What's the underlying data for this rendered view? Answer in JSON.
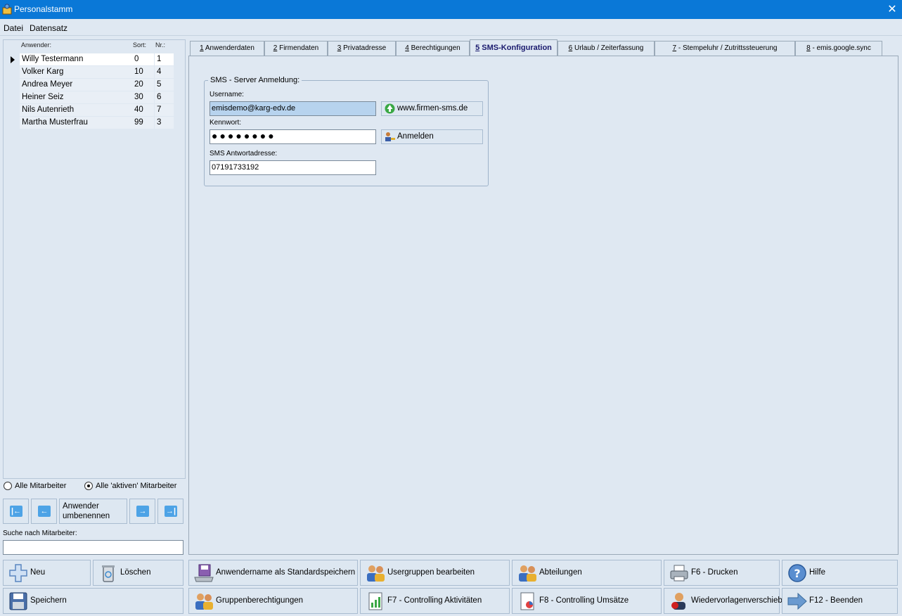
{
  "window": {
    "title": "Personalstamm",
    "close_glyph": "✕"
  },
  "menu": [
    "Datei",
    "Datensatz"
  ],
  "userlist": {
    "headers": {
      "name": "Anwender:",
      "sort": "Sort:",
      "nr": "Nr.:"
    },
    "rows": [
      {
        "name": "Willy Testermann",
        "sort": "0",
        "nr": "1",
        "selected": true
      },
      {
        "name": "Volker Karg",
        "sort": "10",
        "nr": "4"
      },
      {
        "name": "Andrea Meyer",
        "sort": "20",
        "nr": "5"
      },
      {
        "name": "Heiner Seiz",
        "sort": "30",
        "nr": "6"
      },
      {
        "name": "Nils Autenrieth",
        "sort": "40",
        "nr": "7"
      },
      {
        "name": "Martha Musterfrau",
        "sort": "99",
        "nr": "3"
      }
    ]
  },
  "filter": {
    "all": "Alle Mitarbeiter",
    "active": "Alle 'aktiven' Mitarbeiter",
    "selected": "active"
  },
  "nav": {
    "rename_line1": "Anwender",
    "rename_line2": "umbenennen"
  },
  "search": {
    "label": "Suche nach Mitarbeiter:",
    "value": ""
  },
  "tabs": [
    {
      "num": "1",
      "label": " Anwenderdaten"
    },
    {
      "num": "2",
      "label": " Firmendaten"
    },
    {
      "num": "3",
      "label": " Privatadresse"
    },
    {
      "num": "4",
      "label": " Berechtigungen"
    },
    {
      "num": "5",
      "label": " SMS-Konfiguration",
      "active": true
    },
    {
      "num": "6",
      "label": " Urlaub / Zeiterfassung"
    },
    {
      "num": "7",
      "label": " - Stempeluhr / Zutrittssteuerung"
    },
    {
      "num": "8",
      "label": " - emis.google.sync"
    }
  ],
  "sms": {
    "group_title": "SMS - Server Anmeldung:",
    "username_label": "Username:",
    "username_value": "emisdemo@karg-edv.de",
    "link_button": "www.firmen-sms.de",
    "password_label": "Kennwort:",
    "password_value": "●●●●●●●●",
    "login_button": "Anmelden",
    "reply_label": "SMS Antwortadresse:",
    "reply_value": "07191733192"
  },
  "buttons": {
    "neu": "Neu",
    "loeschen": "Löschen",
    "standard_line1": "Anwendername als Standard",
    "standard_line2": "speichern",
    "usergruppen": "Usergruppen bearbeiten",
    "abteilungen": "Abteilungen",
    "drucken": "F6 - Drucken",
    "hilfe": "Hilfe",
    "speichern": "Speichern",
    "gruppenberechtigungen": "Gruppenberechtigungen",
    "controlling_aktivitaeten": "F7 - Controlling Aktivitäten",
    "controlling_umsaetze": "F8 - Controlling Umsätze",
    "wiedervorlagen_line1": "Wiedervorlagen",
    "wiedervorlagen_line2": "verschieben",
    "beenden": "F12 - Beenden"
  },
  "colors": {
    "titlebar": "#0a78d7",
    "background": "#dfe8f2",
    "highlight_input": "#b7d3ee"
  }
}
